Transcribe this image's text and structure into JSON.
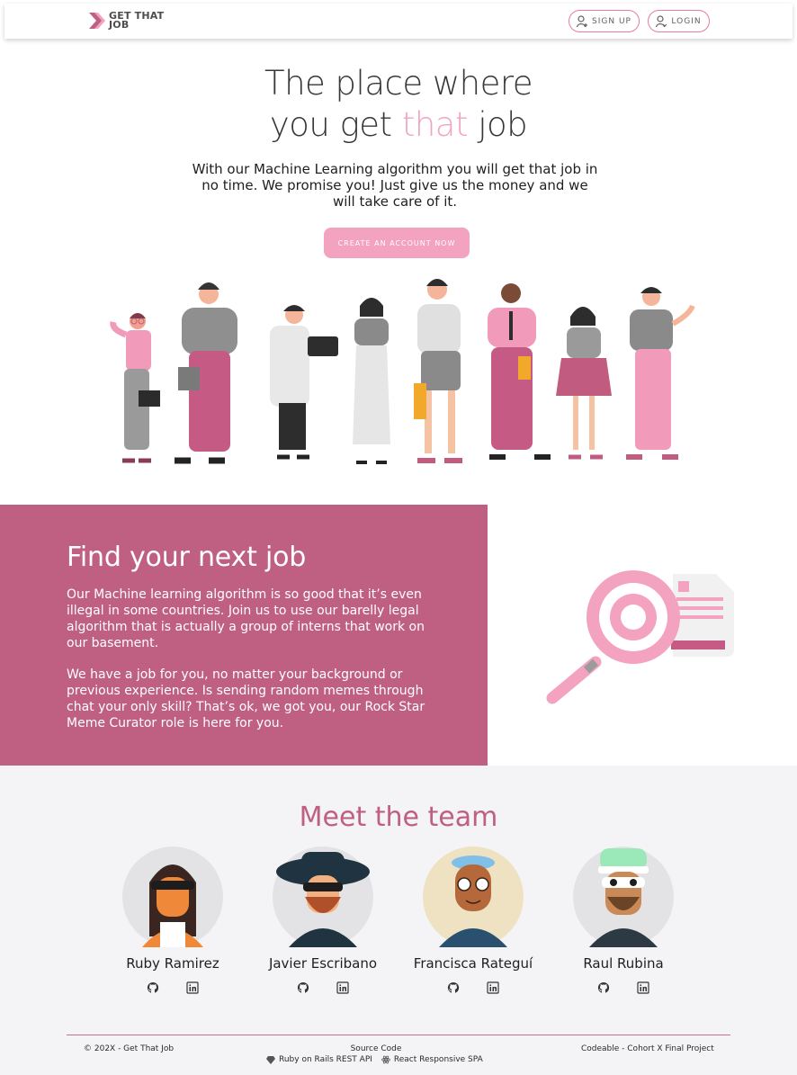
{
  "header": {
    "logo_text": "GET THAT JOB",
    "signup_label": "SIGN UP",
    "login_label": "LOGIN"
  },
  "hero": {
    "title_line1": "The place where",
    "title_line2_start": "you get",
    "title_line2_accent": "that",
    "title_line2_end": "job",
    "subtitle": "With our Machine Learning algorithm you will get that job in no time. We promise you! Just give us the money and we will take care of it.",
    "cta_label": "CREATE AN ACCOUNT NOW"
  },
  "find": {
    "title": "Find your next job",
    "paragraph1": "Our Machine learning algorithm is so good that it’s even illegal in some countries. Join us to use our barelly legal algorithm that is actually a group of interns that work on our basement.",
    "paragraph2": "We have a job for you, no matter your background or previous experience. Is sending random memes through chat your only skill? That’s ok, we got you, our Rock Star Meme Curator role is here for you."
  },
  "team": {
    "title": "Meet the team",
    "members": [
      {
        "name": "Ruby Ramirez"
      },
      {
        "name": "Javier Escribano"
      },
      {
        "name": "Francisca Rateguí"
      },
      {
        "name": "Raul Rubina"
      }
    ]
  },
  "footer": {
    "copyright": "© 202X - Get That Job",
    "source_code": "Source Code",
    "rails_link": "Ruby on Rails REST API",
    "react_link": "React Responsive SPA",
    "project": "Codeable - Cohort X Final Project"
  },
  "colors": {
    "brand_pink": "#f3a2c0",
    "brand_dark_pink": "#bf5f82",
    "team_bg": "#f4f4f6"
  },
  "icons": [
    "logo-chevron-icon",
    "user-plus-icon",
    "user-login-icon",
    "github-icon",
    "linkedin-icon",
    "gem-icon",
    "react-icon"
  ]
}
